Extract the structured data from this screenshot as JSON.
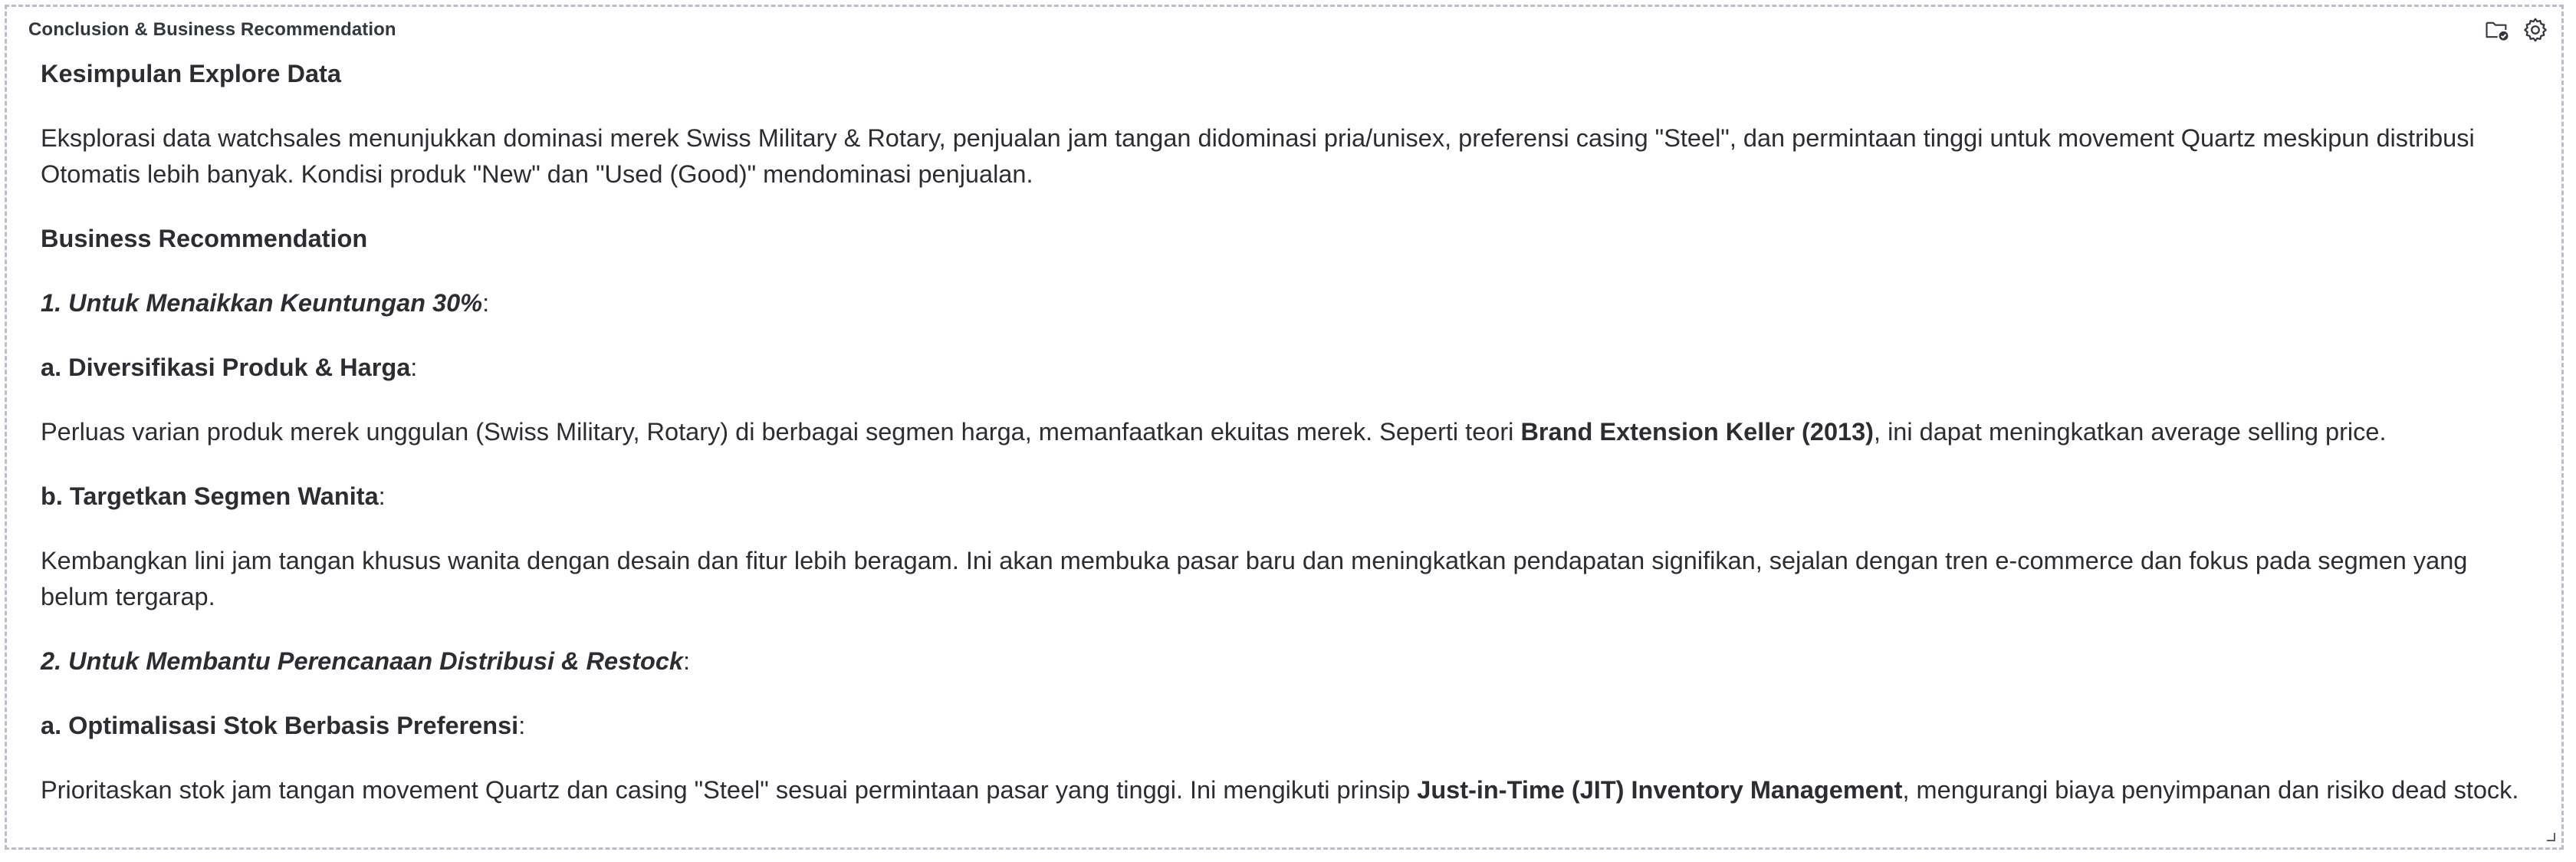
{
  "panel": {
    "title": "Conclusion & Business Recommendation",
    "actions": [
      {
        "icon": "folder-check-icon"
      },
      {
        "icon": "gear-icon"
      }
    ]
  },
  "content": {
    "explore_heading": "Kesimpulan Explore Data",
    "explore_paragraph": "Eksplorasi data watchsales menunjukkan dominasi merek Swiss Military & Rotary, penjualan jam tangan didominasi pria/unisex, preferensi casing \"Steel\", dan permintaan tinggi untuk movement Quartz meskipun distribusi Otomatis lebih banyak. Kondisi produk \"New\" dan \"Used (Good)\" mendominasi penjualan.",
    "business_heading": "Business Recommendation",
    "section1_title": "1. Untuk Menaikkan Keuntungan 30%",
    "section1_a_title": "a. Diversifikasi Produk & Harga",
    "section1_a_text_before": "Perluas varian produk merek unggulan (Swiss Military, Rotary) di berbagai segmen harga, memanfaatkan ekuitas merek. Seperti teori ",
    "section1_a_text_bold": "Brand Extension Keller (2013)",
    "section1_a_text_after": ", ini dapat meningkatkan average selling price.",
    "section1_b_title": "b. Targetkan Segmen Wanita",
    "section1_b_text": "Kembangkan lini jam tangan khusus wanita dengan desain dan fitur lebih beragam. Ini akan membuka pasar baru dan meningkatkan pendapatan signifikan, sejalan dengan tren e-commerce dan fokus pada segmen yang belum tergarap.",
    "section2_title": "2. Untuk Membantu Perencanaan Distribusi & Restock",
    "section2_a_title": "a. Optimalisasi Stok Berbasis Preferensi",
    "section2_a_text_before": "Prioritaskan stok jam tangan movement Quartz dan casing \"Steel\" sesuai permintaan pasar yang tinggi. Ini mengikuti prinsip ",
    "section2_a_text_bold": "Just-in-Time (JIT) Inventory Management",
    "section2_a_text_after": ", mengurangi biaya penyimpanan dan risiko dead stock.",
    "colon": ":"
  }
}
